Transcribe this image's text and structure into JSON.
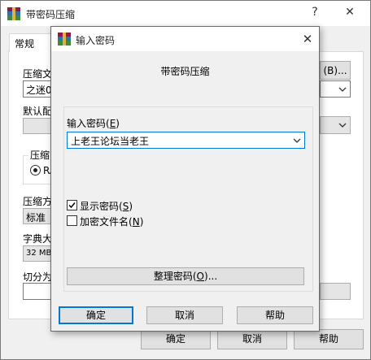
{
  "background_window": {
    "title": "带密码压缩",
    "help_glyph": "?",
    "close_glyph": "✕",
    "tab_general": "常规",
    "archive_name_label": "压缩文",
    "archive_name_value": "之迷0",
    "browse_label": "(B)...",
    "default_profile_label": "默认配",
    "format_group_label": "压缩",
    "format_rar_label": "RA",
    "method_label": "压缩方",
    "method_value": "标准",
    "dict_label": "字典大",
    "dict_value": "32 MB",
    "split_label": "切分为",
    "ok": "确定",
    "cancel": "取消",
    "help": "帮助"
  },
  "dialog": {
    "title": "输入密码",
    "close_glyph": "✕",
    "subtitle": "带密码压缩",
    "password_label": "输入密码",
    "password_accel": "E",
    "password_value": "上老王论坛当老王",
    "show_password_label": "显示密码",
    "show_password_accel": "S",
    "show_password_checked": true,
    "encrypt_names_label": "加密文件名",
    "encrypt_names_accel": "N",
    "encrypt_names_checked": false,
    "organize_label": "整理密码",
    "organize_accel": "O",
    "organize_suffix": "...",
    "ok": "确定",
    "cancel": "取消",
    "help": "帮助"
  },
  "colors": {
    "focus_blue": "#0078d7",
    "window_bg": "#f0f0f0"
  },
  "icons": {
    "app": "winrar-books-icon",
    "dropdown": "chevron-down-icon",
    "check": "check-icon"
  }
}
